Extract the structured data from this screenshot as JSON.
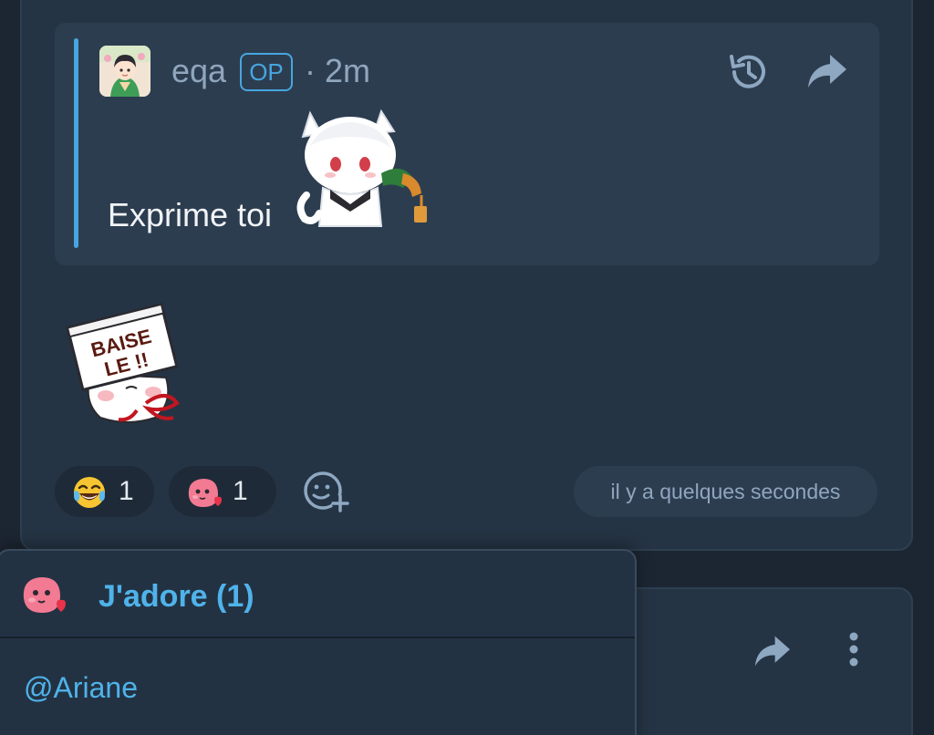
{
  "post": {
    "quote": {
      "author": "eqa",
      "badge": "OP",
      "time": "· 2m",
      "text": "Exprime toi",
      "sticker": "white-cat-boy-pouring-drink"
    },
    "sticker": {
      "name": "baise-le-sign-sticker",
      "caption": "BAISE LE !!"
    },
    "reactions": [
      {
        "emoji": "laughing-tears-emoji",
        "count": "1"
      },
      {
        "emoji": "pink-blob-heart-emoji",
        "count": "1"
      }
    ],
    "timestamp": "il y a quelques secondes"
  },
  "popover": {
    "title": "J'adore (1)",
    "users": [
      "@Ariane"
    ]
  },
  "colors": {
    "accent": "#46a6e0",
    "background": "#1c2632",
    "card": "#253444",
    "quote": "#2d3d50"
  }
}
